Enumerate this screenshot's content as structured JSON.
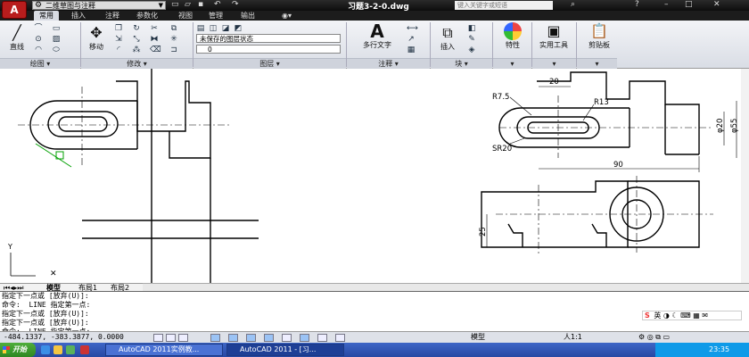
{
  "titlebar": {
    "app_button": "A",
    "workspace": "二维草图与注释",
    "document_title": "习题3-2-0.dwg",
    "help_search_placeholder": "键入关键字或短语"
  },
  "tabs": [
    "常用",
    "插入",
    "注释",
    "参数化",
    "视图",
    "管理",
    "输出"
  ],
  "ribbon": {
    "line_label": "直线",
    "move_label": "移动",
    "layer_state": "未保存的图层状态",
    "layer_current": "0",
    "text_label": "多行文字",
    "insert_label": "插入",
    "properties_label": "特性",
    "utilities_label": "实用工具",
    "clipboard_label": "剪贴板",
    "panels": {
      "draw": "绘图",
      "modify": "修改",
      "layers": "图层",
      "annotation": "注释",
      "block": "块"
    }
  },
  "layout_tabs": [
    "模型",
    "布局1",
    "布局2"
  ],
  "command_lines": [
    "指定下一点或 [放弃(U)]:",
    "命令:  LINE 指定第一点:",
    "指定下一点或 [放弃(U)]:",
    "指定下一点或 [放弃(U)]:",
    "命令:  LINE 指定第一点:"
  ],
  "status": {
    "coordinates": "-484.1337, -383.3877, 0.0000",
    "model_label": "模型",
    "scale": "人1:1"
  },
  "drawing_labels": {
    "r7_5": "R7.5",
    "r13": "R13",
    "sr20": "SR20",
    "dim_20": "20",
    "dim_90": "90",
    "phi20": "φ20",
    "phi55": "φ55",
    "dim_25": "25"
  },
  "ime": {
    "lang": "英"
  },
  "taskbar": {
    "start": "开始",
    "tasks": [
      "AutoCAD 2011实例教...",
      "AutoCAD 2011 - [习..."
    ],
    "clock": "23:35"
  }
}
